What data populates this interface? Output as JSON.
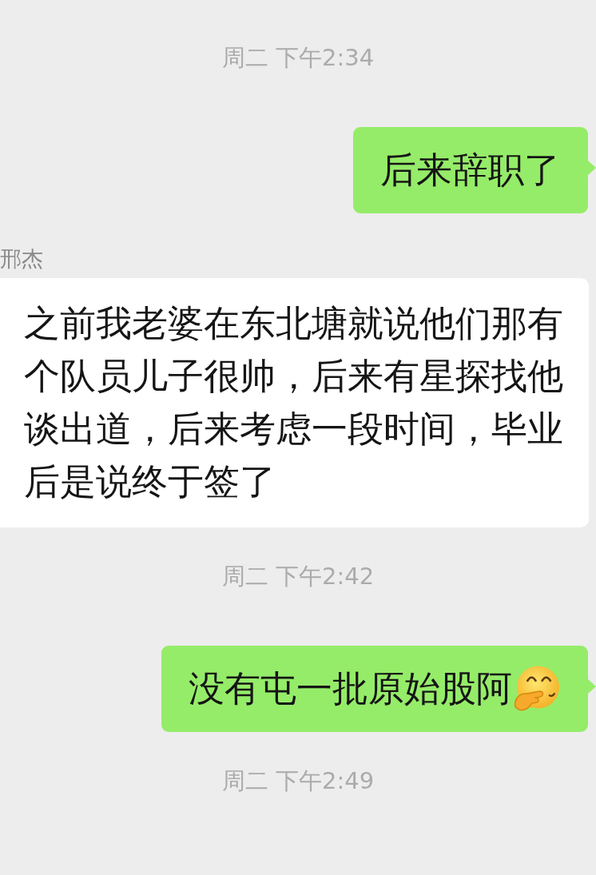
{
  "chat": [
    {
      "kind": "timestamp",
      "text": "周二 下午2:34"
    },
    {
      "kind": "sent",
      "text": "后来辞职了",
      "emoji": false
    },
    {
      "kind": "received",
      "sender": "邢杰",
      "text": "之前我老婆在东北塘就说他们那有个队员儿子很帅，后来有星探找他谈出道，后来考虑一段时间，毕业后是说终于签了",
      "emoji": false
    },
    {
      "kind": "timestamp",
      "text": "周二 下午2:42"
    },
    {
      "kind": "sent",
      "text": "没有屯一批原始股阿",
      "emoji": true
    },
    {
      "kind": "timestamp",
      "text": "周二 下午2:49"
    }
  ]
}
